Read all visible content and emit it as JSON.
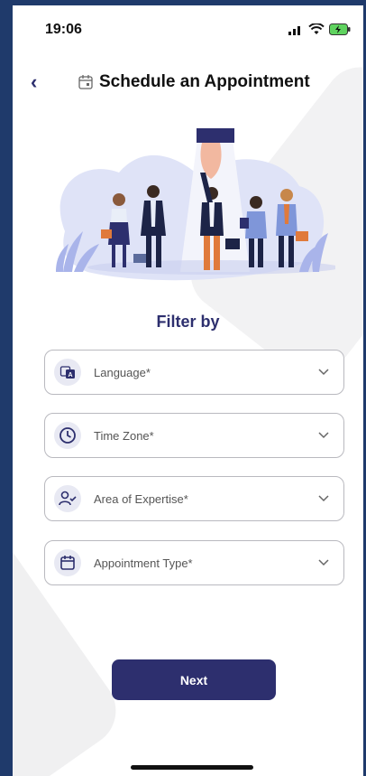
{
  "status": {
    "time": "19:06"
  },
  "header": {
    "back_label": "‹",
    "title": "Schedule an Appointment"
  },
  "filter": {
    "title": "Filter by"
  },
  "fields": [
    {
      "label": "Language*",
      "icon": "language-icon"
    },
    {
      "label": "Time Zone*",
      "icon": "clock-icon"
    },
    {
      "label": "Area of Expertise*",
      "icon": "person-check-icon"
    },
    {
      "label": "Appointment Type*",
      "icon": "calendar-icon"
    }
  ],
  "actions": {
    "next_label": "Next"
  },
  "colors": {
    "primary": "#2d2f6e",
    "frame": "#1f3a6b",
    "field_border": "#b9b9bf",
    "icon_bg": "#e8e9f3"
  }
}
